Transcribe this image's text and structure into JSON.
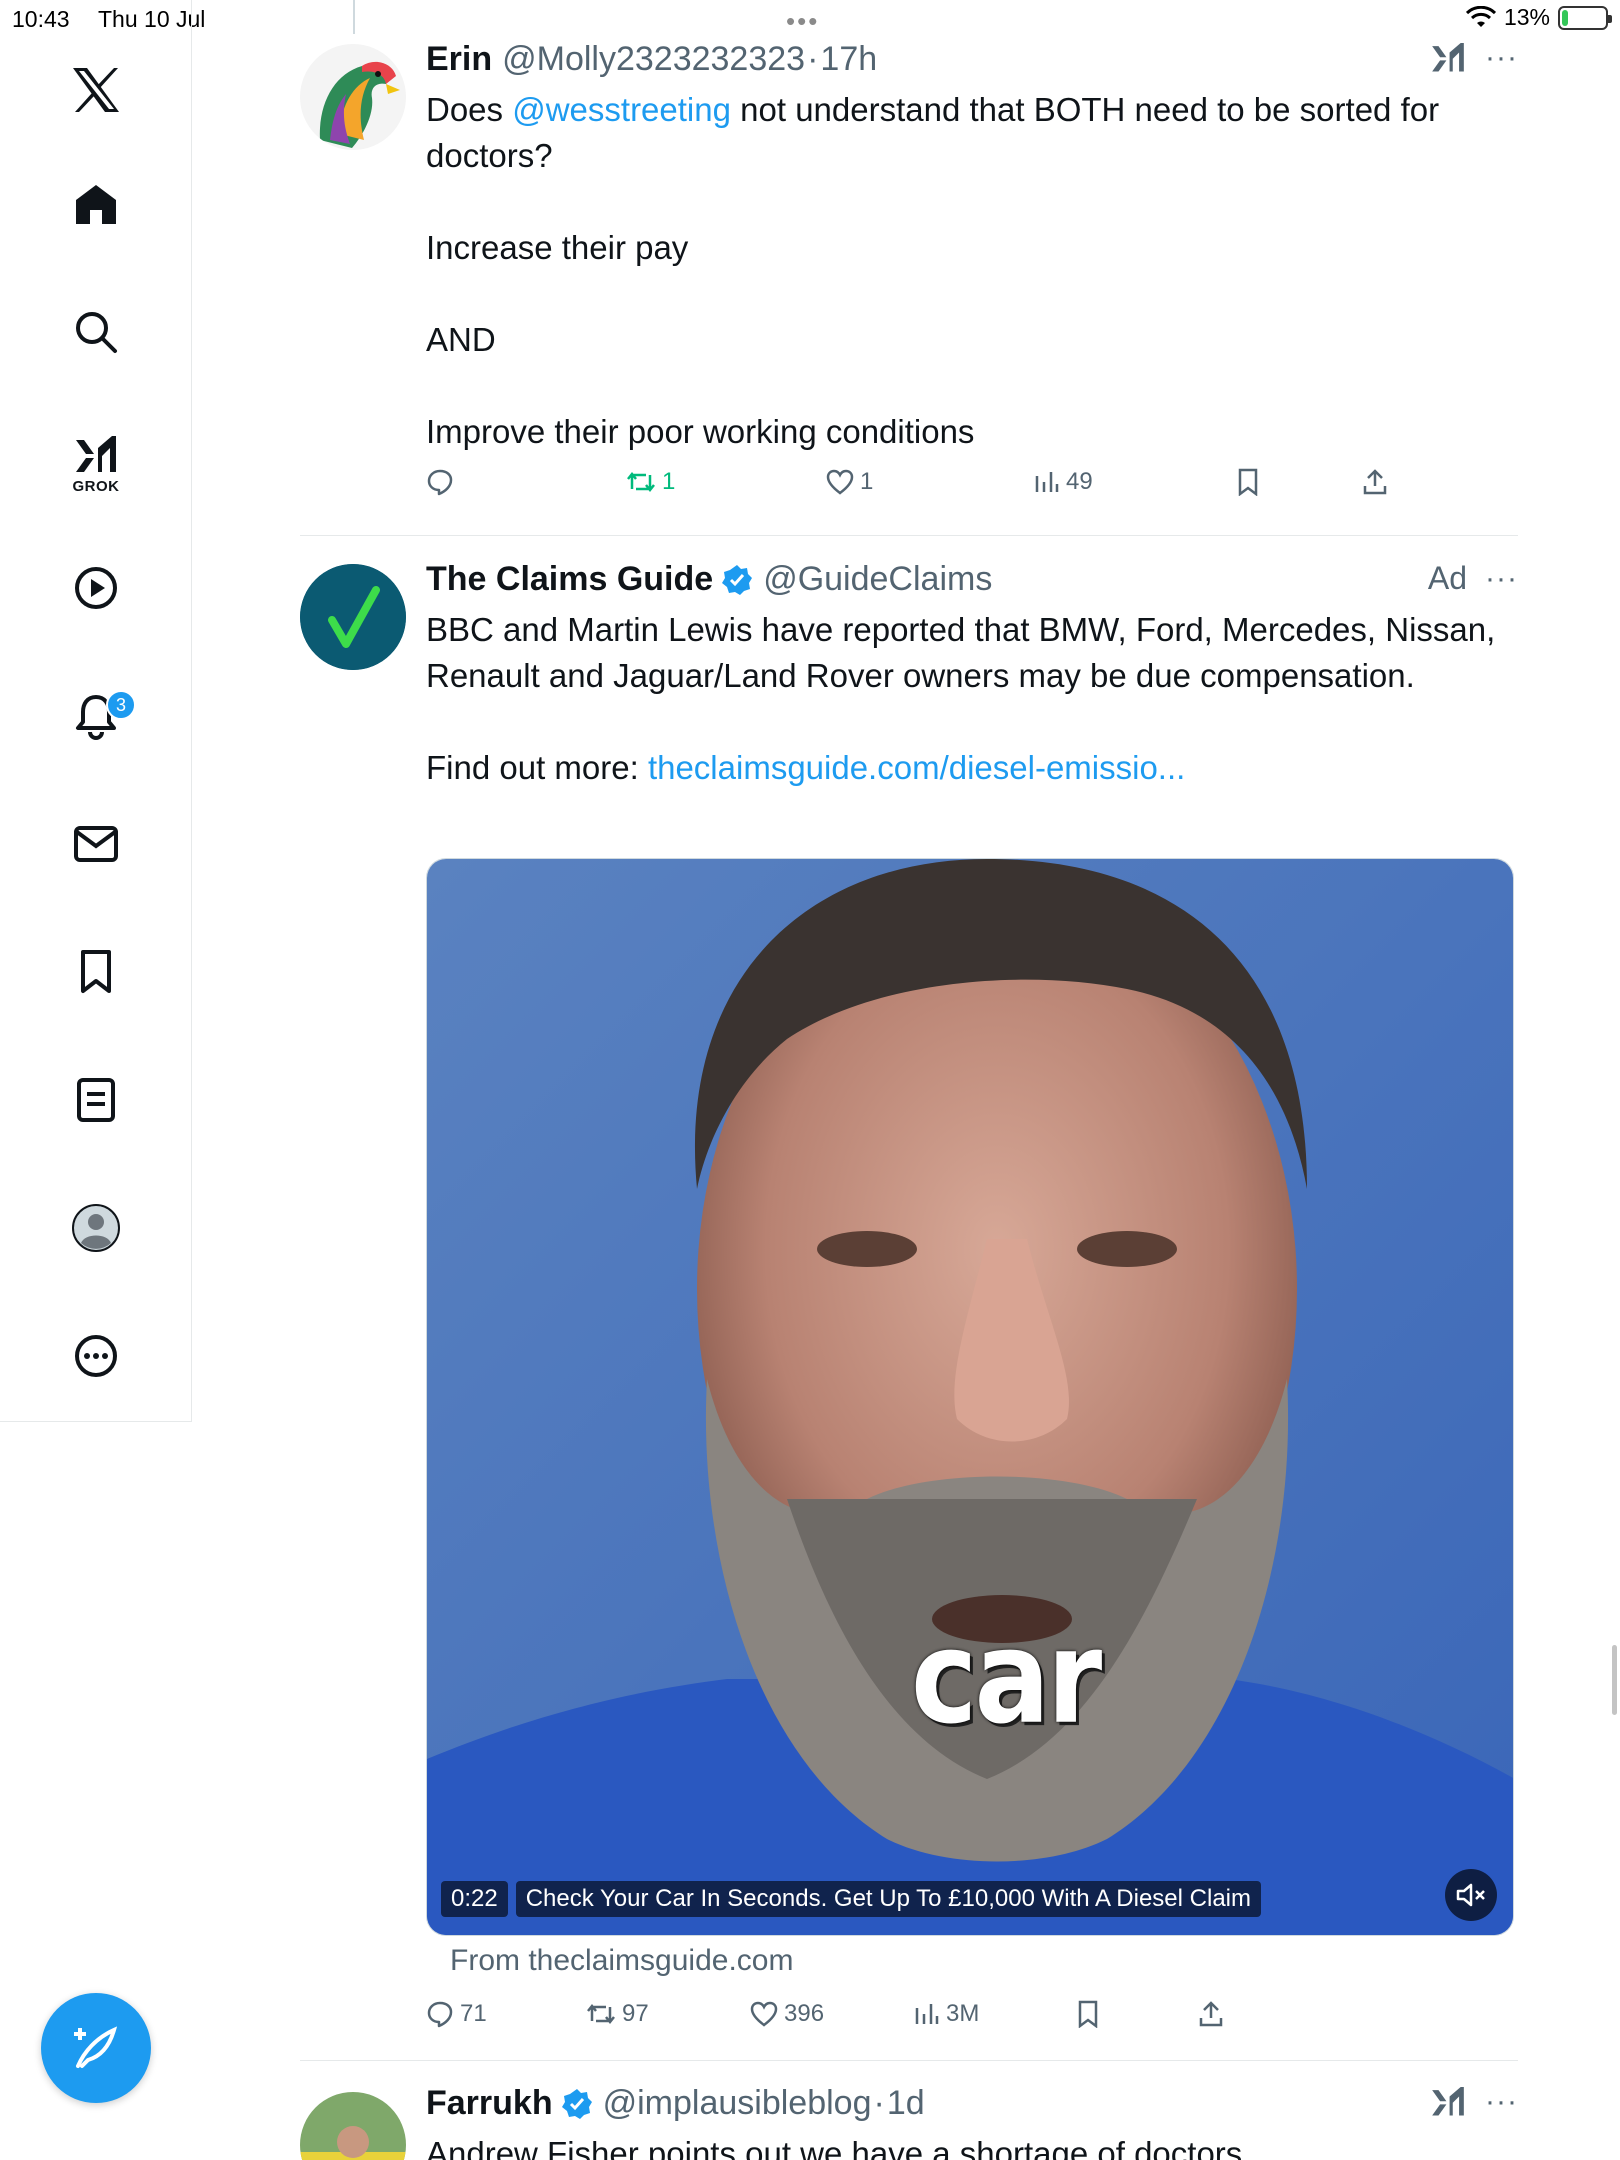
{
  "status_bar": {
    "time": "10:43",
    "date": "Thu 10 Jul",
    "battery": "13%",
    "battery_level": 0.13
  },
  "sidebar": {
    "items": [
      {
        "icon": "x-logo-icon"
      },
      {
        "icon": "home-icon"
      },
      {
        "icon": "search-icon"
      },
      {
        "icon": "grok-icon",
        "label": "GROK"
      },
      {
        "icon": "video-play-icon"
      },
      {
        "icon": "bell-icon",
        "badge": "3"
      },
      {
        "icon": "mail-icon"
      },
      {
        "icon": "bookmark-icon"
      },
      {
        "icon": "lists-icon"
      },
      {
        "icon": "profile-icon"
      },
      {
        "icon": "more-circle-icon"
      }
    ],
    "compose_icon": "compose-feather-icon"
  },
  "tweets": [
    {
      "name": "Erin",
      "handle": "@Molly2323232323",
      "time": "17h",
      "text_pre": "Does ",
      "mention": "@wesstreeting",
      "text_post": " not understand that BOTH need to be sorted for doctors?",
      "lines": [
        "Increase their pay",
        "AND",
        "Improve their poor working conditions"
      ],
      "actions": {
        "replies": "",
        "reposts": "1",
        "likes": "1",
        "views": "49"
      }
    },
    {
      "name": "The Claims Guide",
      "handle": "@GuideClaims",
      "ad_label": "Ad",
      "text": "BBC and Martin Lewis have reported that BMW, Ford, Mercedes, Nissan, Renault and Jaguar/Land Rover owners may be due compensation.",
      "findout_label": "Find out more: ",
      "findout_link": "theclaimsguide.com/diesel-emissio...",
      "video": {
        "duration": "0:22",
        "title": "Check Your Car In Seconds. Get Up To £10,000 With A Diesel Claim",
        "caption_word": "car"
      },
      "from_site": "From theclaimsguide.com",
      "actions": {
        "replies": "71",
        "reposts": "97",
        "likes": "396",
        "views": "3M"
      }
    },
    {
      "name": "Farrukh",
      "handle": "@implausibleblog",
      "time": "1d",
      "text": "Andrew Fisher points out we have a shortage of doctors"
    }
  ],
  "colors": {
    "accent": "#1d9bf0",
    "repost_active": "#00ba7c",
    "secondary_text": "#536471"
  }
}
